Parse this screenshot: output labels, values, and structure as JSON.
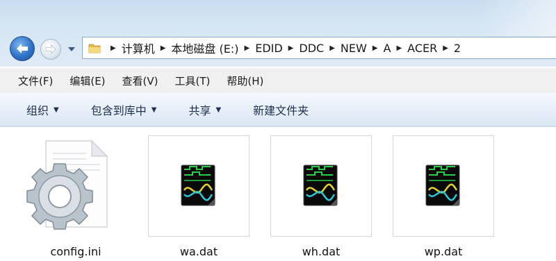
{
  "navigation": {
    "back_icon": "back-arrow-icon",
    "forward_icon": "forward-arrow-icon",
    "recent_icon": "chevron-down-icon"
  },
  "address": {
    "folder_icon": "folder-icon",
    "crumbs": [
      "计算机",
      "本地磁盘 (E:)",
      "EDID",
      "DDC",
      "NEW",
      "A",
      "ACER",
      "2"
    ]
  },
  "menu": {
    "file": "文件(F)",
    "edit": "编辑(E)",
    "view": "查看(V)",
    "tools": "工具(T)",
    "help": "帮助(H)"
  },
  "toolbar": {
    "organize": "组织",
    "include_in_library": "包含到库中",
    "share": "共享",
    "new_folder": "新建文件夹"
  },
  "files": [
    {
      "name": "config.ini",
      "icon": "settings-file-icon"
    },
    {
      "name": "wa.dat",
      "icon": "dat-file-icon"
    },
    {
      "name": "wh.dat",
      "icon": "dat-file-icon"
    },
    {
      "name": "wp.dat",
      "icon": "dat-file-icon"
    }
  ]
}
